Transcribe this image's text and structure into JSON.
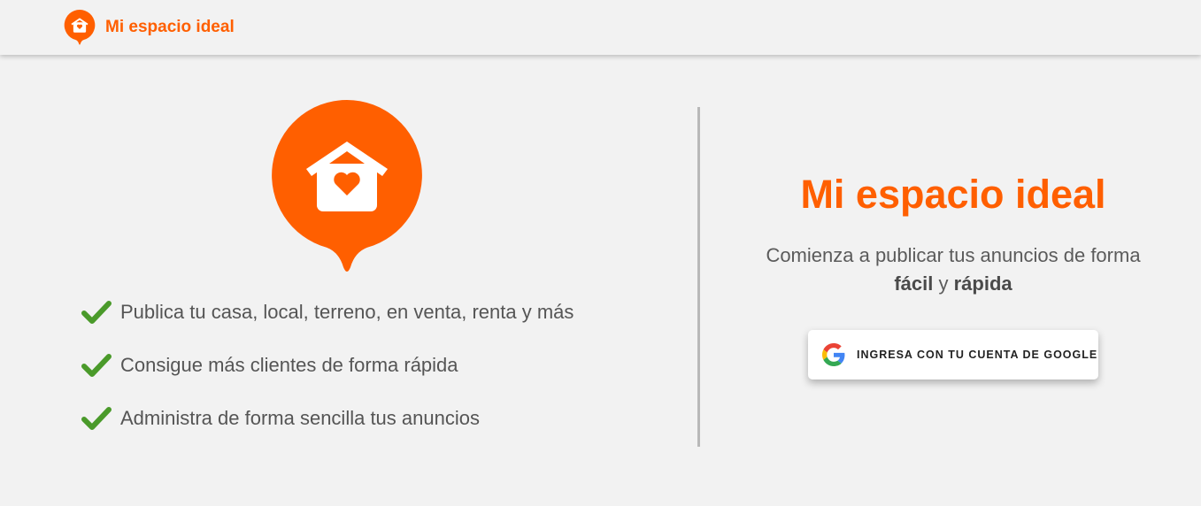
{
  "header": {
    "brand_name": "Mi espacio ideal",
    "logo_icon": "house-heart-pin-icon"
  },
  "features": [
    {
      "icon": "check-icon",
      "text": "Publica tu casa, local, terreno, en venta, renta y más"
    },
    {
      "icon": "check-icon",
      "text": "Consigue más clientes de forma rápida"
    },
    {
      "icon": "check-icon",
      "text": "Administra de forma sencilla tus anuncios"
    }
  ],
  "hero": {
    "logo_icon": "house-heart-pin-icon"
  },
  "login": {
    "title": "Mi espacio ideal",
    "subtitle_part1": "Comienza a publicar tus anuncios de forma ",
    "subtitle_bold1": "fácil",
    "subtitle_part2": " y ",
    "subtitle_bold2": "rápida",
    "google_button_label": "INGRESA CON TU CUENTA DE GOOGLE",
    "google_icon": "google-g-icon"
  },
  "colors": {
    "brand_orange": "#ff5f00",
    "check_green": "#4a9a2a",
    "background": "#f2f2f2",
    "text_gray": "#555555"
  }
}
